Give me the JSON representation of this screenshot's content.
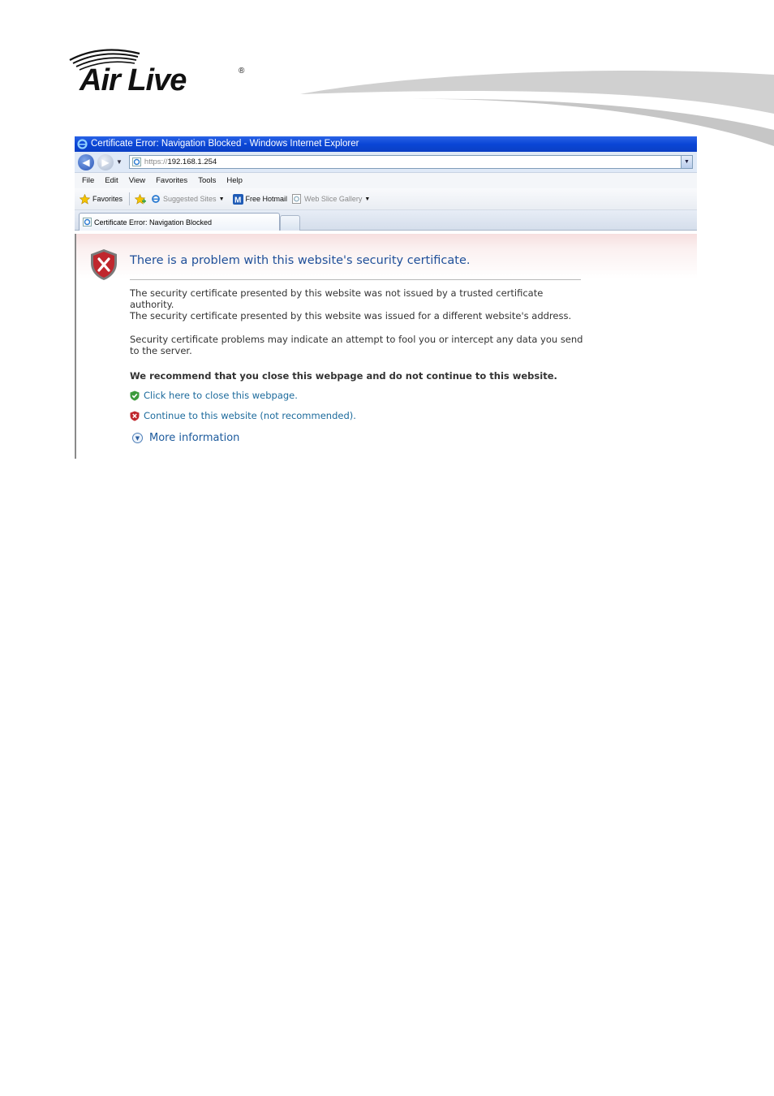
{
  "logo": {
    "brand": "Air Live",
    "registered": "®"
  },
  "browser": {
    "window_title": "Certificate Error: Navigation Blocked - Windows Internet Explorer",
    "url_protocol": "https://",
    "url_host": "192.168.1.254",
    "menu": [
      "File",
      "Edit",
      "View",
      "Favorites",
      "Tools",
      "Help"
    ],
    "favorites_bar": {
      "favorites": "Favorites",
      "suggested_sites": "Suggested Sites",
      "free_hotmail": "Free Hotmail",
      "web_slice_gallery": "Web Slice Gallery"
    },
    "tab_title": "Certificate Error: Navigation Blocked"
  },
  "cert_error": {
    "heading": "There is a problem with this website's security certificate.",
    "para1": "The security certificate presented by this website was not issued by a trusted certificate authority.",
    "para2": "The security certificate presented by this website was issued for a different website's address.",
    "para3": "Security certificate problems may indicate an attempt to fool you or intercept any data you send to the server.",
    "recommendation": "We recommend that you close this webpage and do not continue to this website.",
    "close_link": "Click here to close this webpage.",
    "continue_link": "Continue to this website (not recommended).",
    "more_info": "More information"
  },
  "colors": {
    "titlebar": "#0a46d6",
    "heading": "#1f4f99",
    "link": "#1c6a9c",
    "shield_red": "#c0272d",
    "shield_green": "#3c9a3c"
  }
}
